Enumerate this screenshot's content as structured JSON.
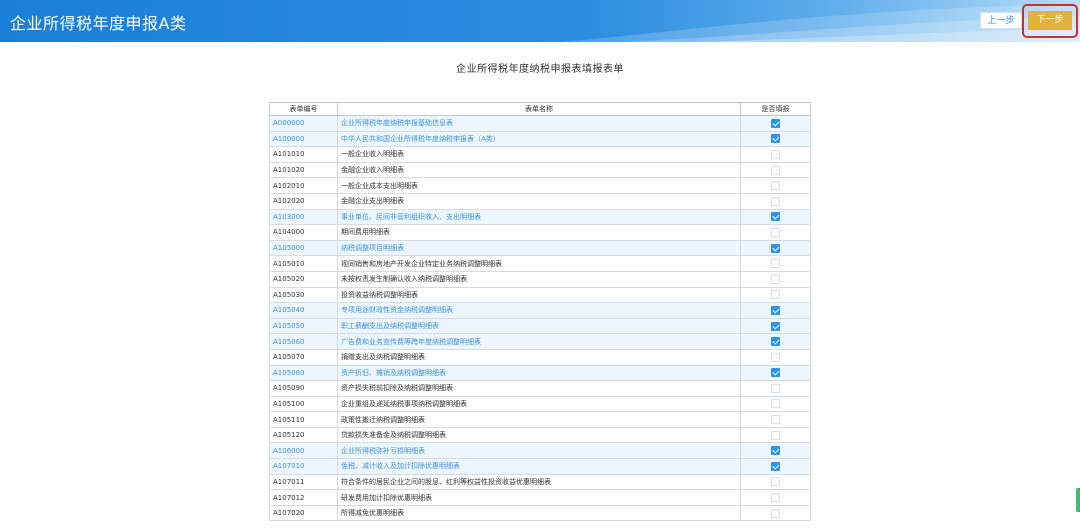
{
  "header": {
    "title": "企业所得税年度申报A类",
    "prev_label": "上一步",
    "next_label": "下一步",
    "accent_color": "#1a7fd8",
    "next_color": "#e2b33b",
    "highlight_color": "#c8312f"
  },
  "form": {
    "title": "企业所得税年度纳税申报表填报表单",
    "columns": [
      "表单编号",
      "表单名称",
      "是否填报"
    ],
    "rows": [
      {
        "code": "A000000",
        "name": "企业所得税年度纳税申报基础信息表",
        "checked": true
      },
      {
        "code": "A100000",
        "name": "中华人民共和国企业所得税年度纳税申报表（A类）",
        "checked": true
      },
      {
        "code": "A101010",
        "name": "一般企业收入明细表",
        "checked": false
      },
      {
        "code": "A101020",
        "name": "金融企业收入明细表",
        "checked": false
      },
      {
        "code": "A102010",
        "name": "一般企业成本支出明细表",
        "checked": false
      },
      {
        "code": "A102020",
        "name": "金融企业支出明细表",
        "checked": false
      },
      {
        "code": "A103000",
        "name": "事业单位、民间非营利组织收入、支出明细表",
        "checked": true
      },
      {
        "code": "A104000",
        "name": "期间费用明细表",
        "checked": false
      },
      {
        "code": "A105000",
        "name": "纳税调整项目明细表",
        "checked": true
      },
      {
        "code": "A105010",
        "name": "视同销售和房地产开发企业特定业务纳税调整明细表",
        "checked": false
      },
      {
        "code": "A105020",
        "name": "未按权责发生制确认收入纳税调整明细表",
        "checked": false
      },
      {
        "code": "A105030",
        "name": "投资收益纳税调整明细表",
        "checked": false
      },
      {
        "code": "A105040",
        "name": "专项用途财政性资金纳税调整明细表",
        "checked": true
      },
      {
        "code": "A105050",
        "name": "职工薪酬支出及纳税调整明细表",
        "checked": true
      },
      {
        "code": "A105060",
        "name": "广告费和业务宣传费等跨年度纳税调整明细表",
        "checked": true
      },
      {
        "code": "A105070",
        "name": "捐赠支出及纳税调整明细表",
        "checked": false
      },
      {
        "code": "A105080",
        "name": "资产折旧、摊销及纳税调整明细表",
        "checked": true
      },
      {
        "code": "A105090",
        "name": "资产损失税前扣除及纳税调整明细表",
        "checked": false
      },
      {
        "code": "A105100",
        "name": "企业重组及递延纳税事项纳税调整明细表",
        "checked": false
      },
      {
        "code": "A105110",
        "name": "政策性搬迁纳税调整明细表",
        "checked": false
      },
      {
        "code": "A105120",
        "name": "贷款损失准备金及纳税调整明细表",
        "checked": false
      },
      {
        "code": "A106000",
        "name": "企业所得税弥补亏损明细表",
        "checked": true
      },
      {
        "code": "A107010",
        "name": "免税、减计收入及加计扣除优惠明细表",
        "checked": true
      },
      {
        "code": "A107011",
        "name": "符合条件的居民企业之间的股息、红利等权益性投资收益优惠明细表",
        "checked": false
      },
      {
        "code": "A107012",
        "name": "研发费用加计扣除优惠明细表",
        "checked": false
      },
      {
        "code": "A107020",
        "name": "所得减免优惠明细表",
        "checked": false
      }
    ]
  }
}
